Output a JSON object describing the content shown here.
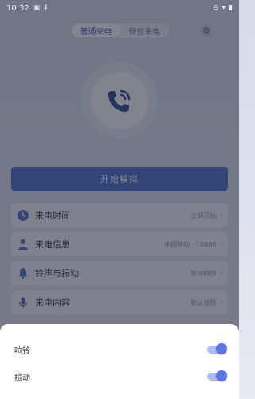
{
  "status_bar": {
    "time": "10:32",
    "left_icons": [
      "image-icon",
      "download-icon"
    ],
    "right_icons": [
      "dnd-icon",
      "wifi-icon",
      "battery-icon"
    ]
  },
  "tabs": [
    {
      "label": "普通来电",
      "active": true
    },
    {
      "label": "微信来电",
      "active": false
    }
  ],
  "settings_icon": "gear-icon",
  "phone_icon": "phone-call-icon",
  "start_button": {
    "label": "开始模拟"
  },
  "settings_rows": [
    {
      "icon": "clock-icon",
      "label": "来电时间",
      "value": "立即开始"
    },
    {
      "icon": "person-icon",
      "label": "来电信息",
      "value": "中国移动 · 10086"
    },
    {
      "icon": "bell-icon",
      "label": "铃声与振动",
      "value": "振动响铃"
    },
    {
      "icon": "mic-icon",
      "label": "来电内容",
      "value": "默认音频"
    }
  ],
  "sheet": {
    "options": [
      {
        "label": "响铃",
        "enabled": true
      },
      {
        "label": "振动",
        "enabled": true
      }
    ]
  },
  "colors": {
    "accent": "#4f6fc8",
    "toggle_on": "#5b74e8"
  }
}
